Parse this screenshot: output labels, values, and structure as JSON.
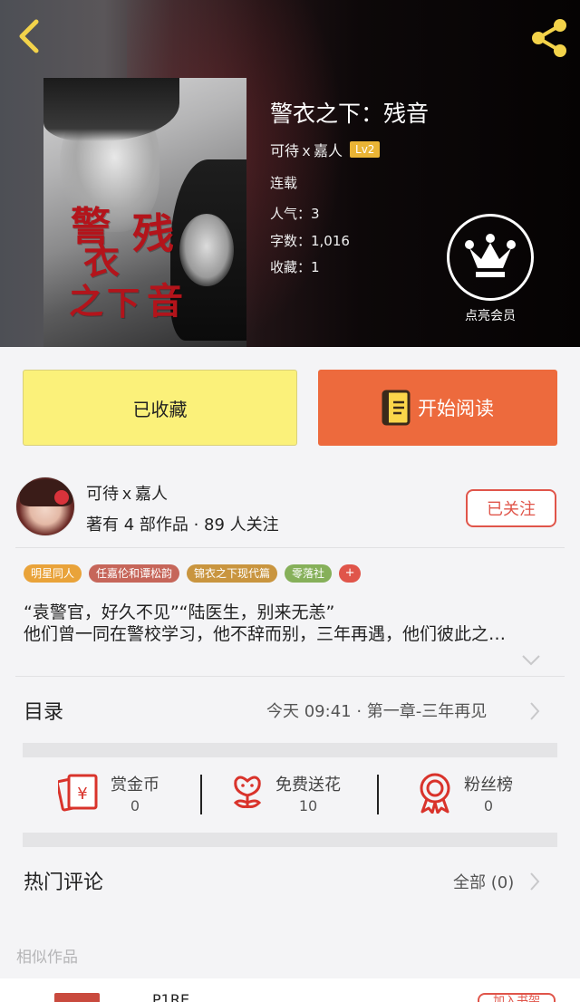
{
  "hero": {
    "title": "警衣之下：残音",
    "author": "可待ｘ嘉人",
    "level": "Lv2",
    "status": "连载",
    "popularity": "人气：3",
    "word_count": "字数：1,016",
    "favorites": "收藏：1",
    "vip_label": "点亮会员",
    "cover_title": [
      "警",
      "衣",
      "之",
      "下",
      "残",
      "音"
    ]
  },
  "icons": {
    "back": "chevron-left-icon",
    "share": "share-icon",
    "vip": "crown-icon",
    "read": "book-icon",
    "reward": "red-envelope-icon",
    "flower": "flower-icon",
    "fans": "medal-icon"
  },
  "actions": {
    "collected_label": "已收藏",
    "read_label": "开始阅读"
  },
  "author_card": {
    "name": "可待ｘ嘉人",
    "stats": "著有 4 部作品 · 89 人关注",
    "follow_label": "已关注"
  },
  "tags": [
    {
      "label": "明星同人",
      "color": "#e9a33a"
    },
    {
      "label": "任嘉伦和谭松韵",
      "color": "#c6665a"
    },
    {
      "label": "锦衣之下现代篇",
      "color": "#c9953f"
    },
    {
      "label": "零落社",
      "color": "#86b05a"
    },
    {
      "label": "+",
      "color": "#e0554a"
    }
  ],
  "summary": {
    "line1": "“袁警官，好久不见”“陆医生，别来无恙”",
    "line2": "他们曾一同在警校学习，他不辞而别，三年再遇，他们彼此之…"
  },
  "toc": {
    "title": "目录",
    "latest": "今天 09:41 · 第一章-三年再见"
  },
  "fan_stats": {
    "reward": {
      "label": "赏金币",
      "value": "0"
    },
    "flower": {
      "label": "免费送花",
      "value": "10"
    },
    "fans": {
      "label": "粉丝榜",
      "value": "0"
    }
  },
  "comments": {
    "title": "热门评论",
    "all_label": "全部 (0)"
  },
  "similar": {
    "label": "相似作品",
    "first_item_name": "P1RE",
    "add_button": "加入书架"
  },
  "colors": {
    "accent_orange": "#ed6a3d",
    "collected_yellow": "#fbf17a",
    "follow_red": "#e0554a",
    "level_gold": "#e9b435"
  }
}
